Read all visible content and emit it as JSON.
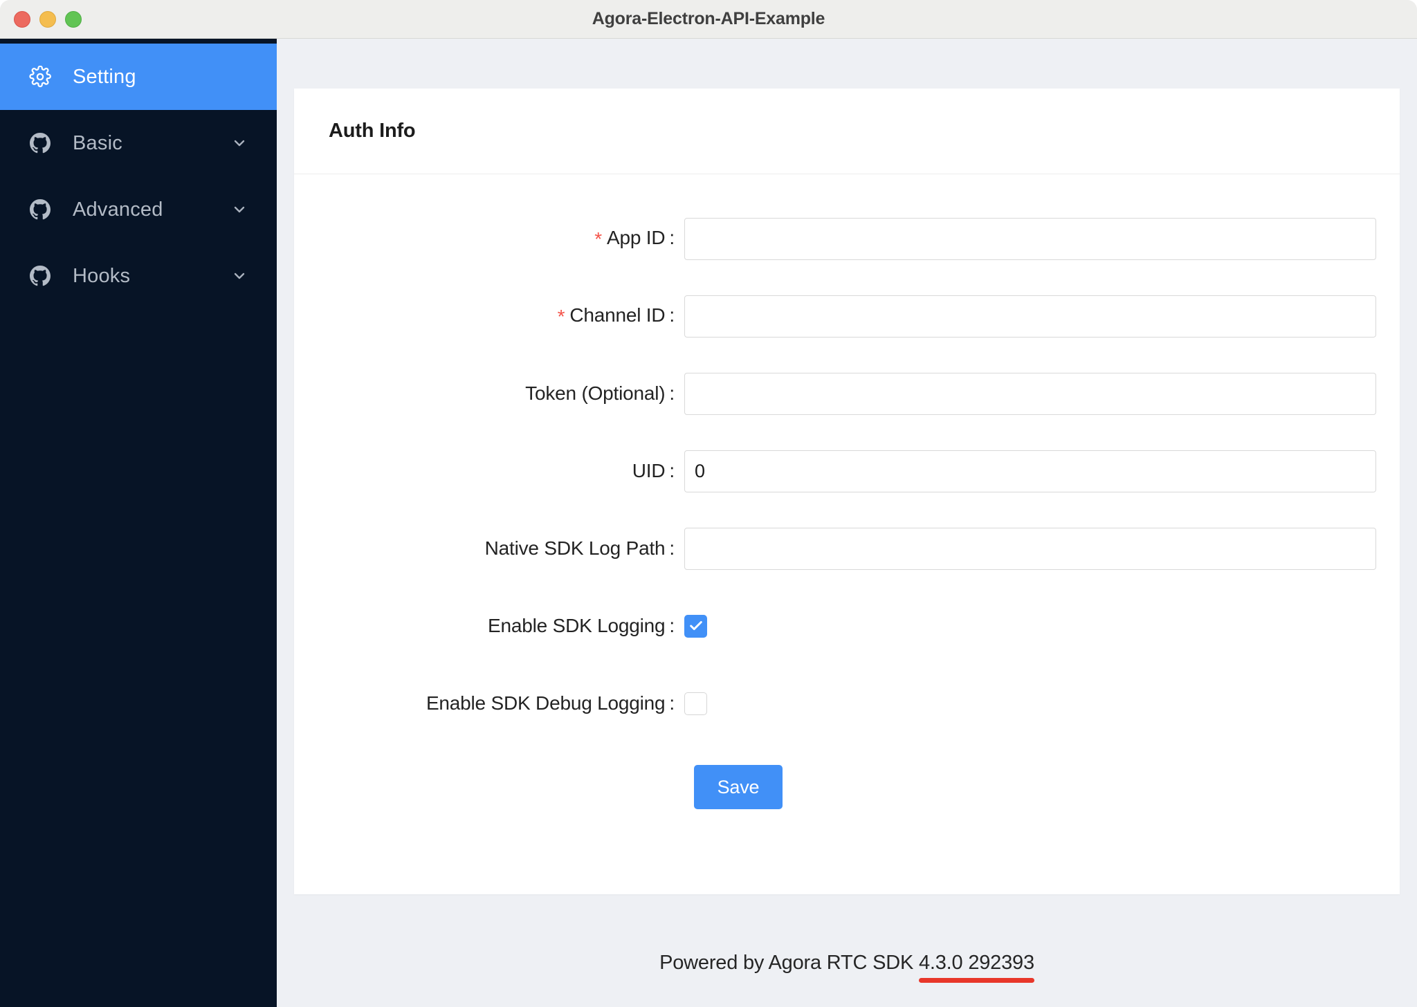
{
  "window": {
    "title": "Agora-Electron-API-Example",
    "traffic_lights": [
      "close",
      "minimize",
      "maximize"
    ]
  },
  "sidebar": {
    "items": [
      {
        "label": "Setting",
        "icon": "gear-icon",
        "active": true,
        "expandable": false
      },
      {
        "label": "Basic",
        "icon": "github-icon",
        "active": false,
        "expandable": true
      },
      {
        "label": "Advanced",
        "icon": "github-icon",
        "active": false,
        "expandable": true
      },
      {
        "label": "Hooks",
        "icon": "github-icon",
        "active": false,
        "expandable": true
      }
    ]
  },
  "card": {
    "title": "Auth Info",
    "fields": [
      {
        "label": "App ID",
        "required": true,
        "value": "",
        "placeholder": ""
      },
      {
        "label": "Channel ID",
        "required": true,
        "value": "",
        "placeholder": ""
      },
      {
        "label": "Token (Optional)",
        "required": false,
        "value": "",
        "placeholder": ""
      },
      {
        "label": "UID",
        "required": false,
        "value": "0",
        "placeholder": ""
      },
      {
        "label": "Native SDK Log Path",
        "required": false,
        "value": "",
        "placeholder": ""
      }
    ],
    "checkboxes": [
      {
        "label": "Enable SDK Logging",
        "checked": true
      },
      {
        "label": "Enable SDK Debug Logging",
        "checked": false
      }
    ],
    "save_label": "Save"
  },
  "footer": {
    "prefix": "Powered by Agora RTC SDK ",
    "sdk_version": "4.3.0 292393",
    "highlight_color": "#e8372a"
  },
  "colors": {
    "accent": "#4190f7",
    "sidebar_bg": "#071426",
    "page_bg": "#eef0f4",
    "required_star": "#f4544a"
  }
}
